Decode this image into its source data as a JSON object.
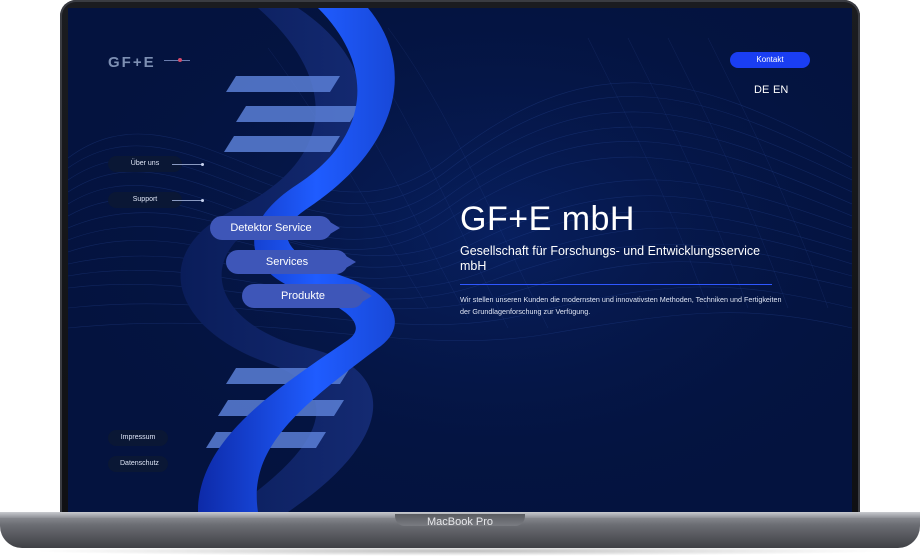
{
  "device": {
    "label": "MacBook Pro"
  },
  "site": {
    "logo": "GF+E",
    "header": {
      "contact_label": "Kontakt",
      "languages": [
        "DE",
        "EN"
      ]
    },
    "side_links": [
      "Über uns",
      "Support"
    ],
    "nav": [
      "Detektor Service",
      "Services",
      "Produkte"
    ],
    "footer_links": [
      "Impressum",
      "Datenschutz"
    ],
    "hero": {
      "title": "GF+E mbH",
      "subtitle": "Gesellschaft für Forschungs- und Entwicklungsservice mbH",
      "description": "Wir stellen unseren Kunden die modernsten und innovativsten Methoden, Techniken und Fertigkeiten der Grundlagenforschung zur Verfügung."
    },
    "colors": {
      "background": "#04133f",
      "accent": "#1a3ef2",
      "helix": "#1e5cff",
      "nav_pill": "#3e56b8"
    }
  }
}
